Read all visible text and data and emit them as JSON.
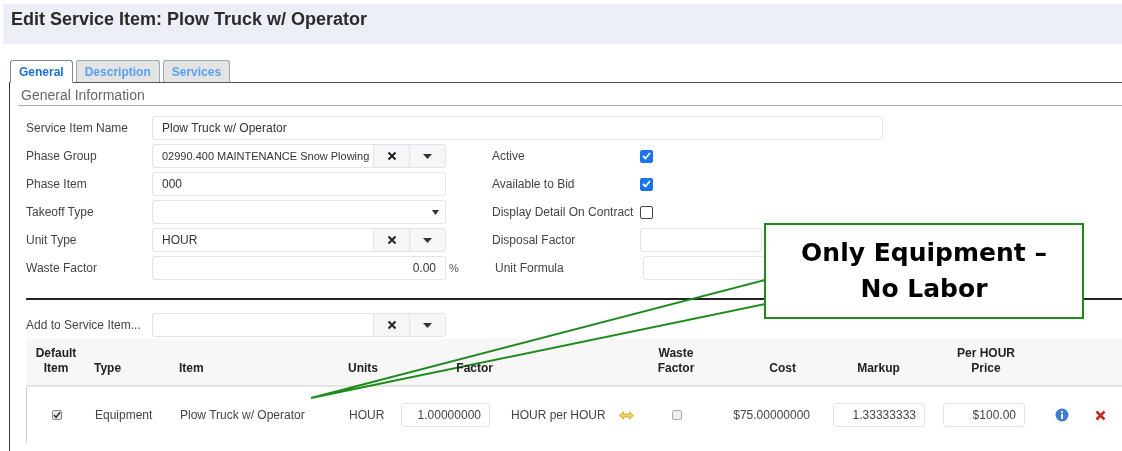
{
  "title": "Edit Service Item: Plow Truck w/ Operator",
  "tabs": [
    {
      "label": "General",
      "selected": true
    },
    {
      "label": "Description",
      "selected": false
    },
    {
      "label": "Services",
      "selected": false
    }
  ],
  "section_title": "General Information",
  "name_field": {
    "label": "Service Item Name",
    "value": "Plow Truck w/ Operator"
  },
  "left_fields": [
    {
      "kind": "combo",
      "label": "Phase Group",
      "value": "02990.400 MAINTENANCE Snow Plowing"
    },
    {
      "kind": "text",
      "label": "Phase Item",
      "value": "000"
    },
    {
      "kind": "select",
      "label": "Takeoff Type"
    },
    {
      "kind": "combo",
      "label": "Unit Type",
      "value": "HOUR"
    },
    {
      "kind": "number",
      "label": "Waste Factor",
      "value": "0.00",
      "suffix": "%"
    }
  ],
  "right_fields": [
    {
      "kind": "checkbox",
      "label": "Active",
      "checked": true
    },
    {
      "kind": "checkbox",
      "label": "Available to Bid",
      "checked": true
    },
    {
      "kind": "checkbox",
      "label": "Display Detail On Contract",
      "checked": false
    },
    {
      "kind": "text",
      "label": "Disposal Factor"
    },
    {
      "kind": "text",
      "label": "Unit Formula"
    }
  ],
  "add_field": {
    "label": "Add to Service Item..."
  },
  "table": {
    "headings": [
      {
        "lines": [
          "Default",
          "Item"
        ]
      },
      {
        "lines": [
          "Type"
        ]
      },
      {
        "lines": [
          "Item"
        ]
      },
      {
        "lines": [
          "Units"
        ]
      },
      {
        "lines": [
          "Factor"
        ]
      },
      {
        "lines": [
          "Waste",
          "Factor"
        ]
      },
      {
        "lines": [
          "Cost"
        ]
      },
      {
        "lines": [
          "Markup"
        ]
      },
      {
        "lines": [
          "Per HOUR",
          "Price"
        ]
      }
    ],
    "rows": [
      {
        "default_checked": true,
        "type": "Equipment",
        "item": "Plow Truck w/ Operator",
        "units": "HOUR",
        "factor": "1.00000000",
        "factor_unit": "HOUR per HOUR",
        "waste_checked": false,
        "cost": "$75.00000000",
        "markup": "1.33333333",
        "price": "$100.00"
      }
    ]
  },
  "callout": {
    "lines": [
      "Only Equipment –",
      "No Labor"
    ]
  }
}
